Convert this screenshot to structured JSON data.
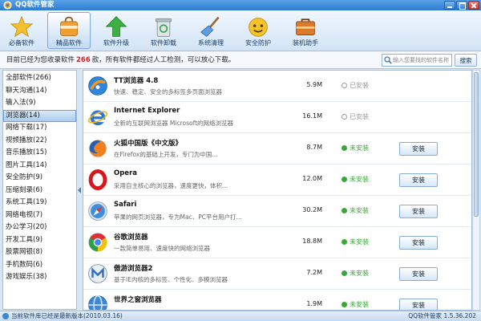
{
  "window": {
    "title": "QQ软件管家"
  },
  "toolbar": {
    "active_index": 1,
    "items": [
      {
        "label": "必备软件",
        "icon": "star-icon"
      },
      {
        "label": "精品软件",
        "icon": "package-icon"
      },
      {
        "label": "软件升级",
        "icon": "upgrade-arrow-icon"
      },
      {
        "label": "软件卸载",
        "icon": "trash-icon"
      },
      {
        "label": "系统清理",
        "icon": "broom-icon"
      },
      {
        "label": "安全防护",
        "icon": "smiley-icon"
      },
      {
        "label": "装机助手",
        "icon": "toolbox-icon"
      }
    ]
  },
  "info": {
    "prefix": "目前已经为您收录软件",
    "count": "266",
    "suffix": "款，所有软件都经过人工检测，可以放心下载。"
  },
  "search": {
    "placeholder": "输入您要找的软件名称",
    "button_label": "搜索"
  },
  "sidebar": {
    "selected_index": 3,
    "items": [
      {
        "label": "全部软件(266)"
      },
      {
        "label": "聊天沟通(14)"
      },
      {
        "label": "输入法(9)"
      },
      {
        "label": "浏览器(14)"
      },
      {
        "label": "网络下载(17)"
      },
      {
        "label": "视频播放(22)"
      },
      {
        "label": "音乐播放(15)"
      },
      {
        "label": "图片工具(14)"
      },
      {
        "label": "安全防护(9)"
      },
      {
        "label": "压缩刻录(6)"
      },
      {
        "label": "系统工具(19)"
      },
      {
        "label": "网络电视(7)"
      },
      {
        "label": "办公学习(20)"
      },
      {
        "label": "开发工具(9)"
      },
      {
        "label": "股票网银(8)"
      },
      {
        "label": "手机数码(6)"
      },
      {
        "label": "游戏娱乐(38)"
      }
    ]
  },
  "software": [
    {
      "name": "TT浏览器 4.8",
      "desc": "快速、稳定、安全的多标签多页面浏览器",
      "size": "5.9M",
      "status": "已安装",
      "installed": true,
      "icon": "tt-browser-icon"
    },
    {
      "name": "Internet Explorer",
      "desc": "全新的互联网浏览器 Microsoft的网络浏览器",
      "size": "16.1M",
      "status": "已安装",
      "installed": true,
      "icon": "ie-icon"
    },
    {
      "name": "火狐中国版《中文版》",
      "desc": "在Firefox的基础上开发，专门为中国...",
      "size": "8.7M",
      "status": "未安装",
      "installed": false,
      "action": "安装",
      "icon": "firefox-icon"
    },
    {
      "name": "Opera",
      "desc": "采用自主核心的浏览器，速度更快，体积...",
      "size": "12.0M",
      "status": "未安装",
      "installed": false,
      "action": "安装",
      "icon": "opera-icon"
    },
    {
      "name": "Safari",
      "desc": "苹果的网页浏览器，专为Mac、PC平台用户打...",
      "size": "30.2M",
      "status": "未安装",
      "installed": false,
      "action": "安装",
      "icon": "safari-icon"
    },
    {
      "name": "谷歌浏览器",
      "desc": "一款简单易用、速度快的网络浏览器",
      "size": "18.8M",
      "status": "未安装",
      "installed": false,
      "action": "安装",
      "icon": "chrome-icon"
    },
    {
      "name": "傲游浏览器2",
      "desc": "基于IE内核的多标签、个性化、多模浏览器",
      "size": "7.2M",
      "status": "未安装",
      "installed": false,
      "action": "安装",
      "icon": "maxthon-icon"
    },
    {
      "name": "世界之窗浏览器",
      "size": "1.9M",
      "status": "未安装",
      "installed": false,
      "action": "安装",
      "icon": "theworld-icon"
    }
  ],
  "statusbar": {
    "left": "当前软件库已经是最新版本(2010.03.16)",
    "right": "QQ软件管家 1.5.36.202"
  },
  "colors": {
    "count": "#e02020",
    "installed": "#9a9a9a",
    "not_installed": "#39a83a"
  }
}
